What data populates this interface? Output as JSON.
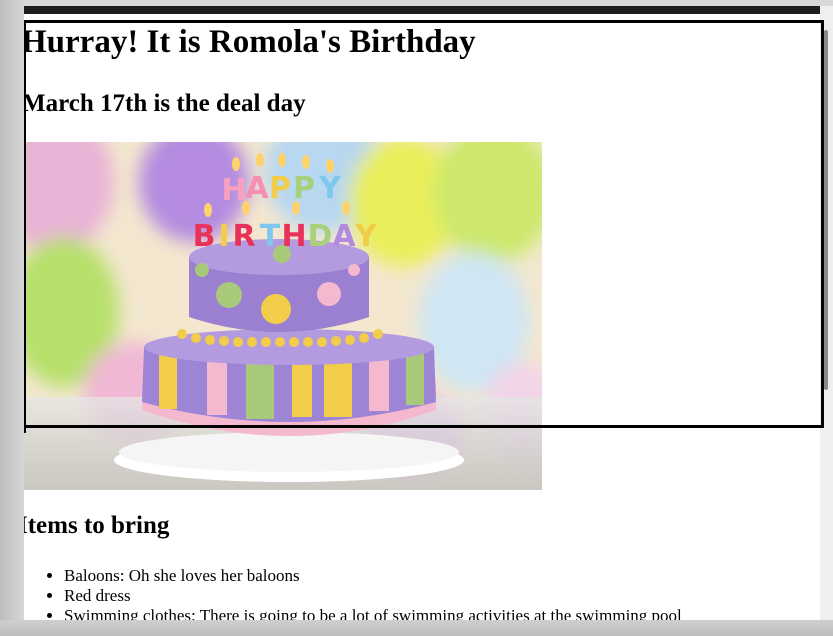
{
  "page": {
    "title": "Hurray! It is Romola's Birthday",
    "subtitle": "March 17th is the deal day",
    "image": {
      "alt": "Birthday cake",
      "candle_text": "HAPPY BIRTHDAY"
    },
    "items_heading": "Items to bring",
    "items": [
      "Baloons: Oh she loves her baloons",
      "Red dress",
      "Swimming clothes: There is going to be a lot of swimming activities at the swimming pool"
    ]
  },
  "colors": {
    "page_background": "#ffffff",
    "frame_border": "#000000",
    "topbar": "#1e1e1e",
    "cake_purple": "#9b7fd0",
    "cake_yellow": "#f2cd4a",
    "cake_green": "#a9c97a",
    "cake_pink": "#f3b6cf"
  },
  "icons": {
    "bullet": "disc"
  }
}
